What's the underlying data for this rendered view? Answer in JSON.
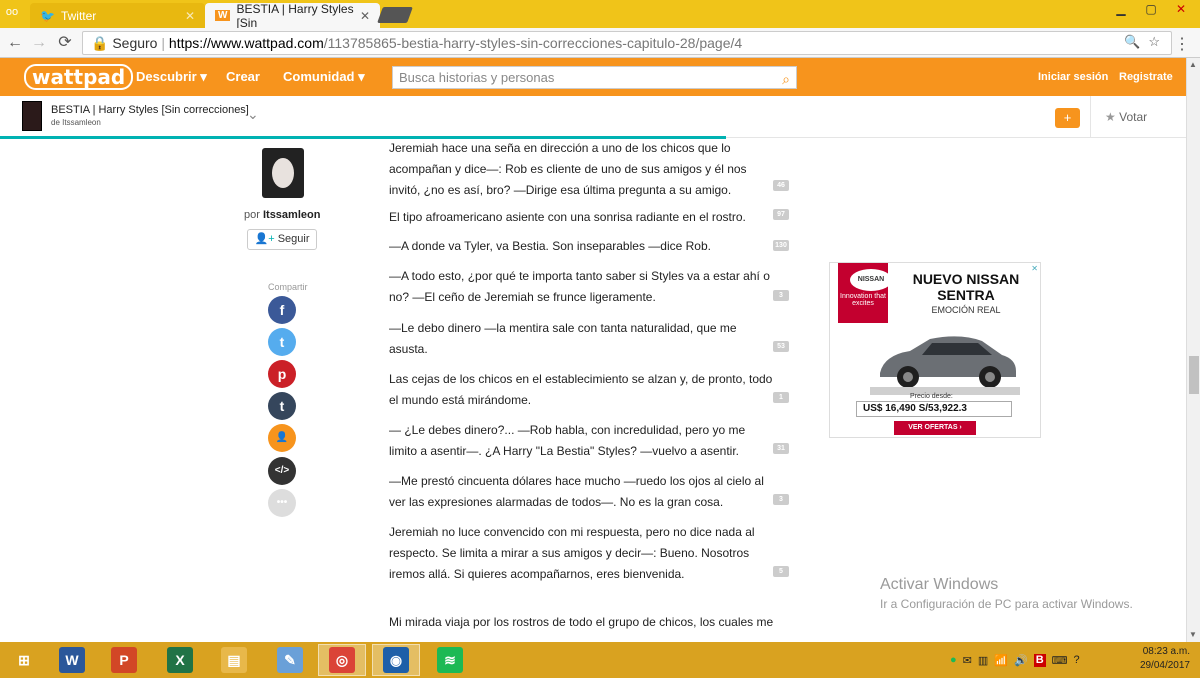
{
  "browser": {
    "tabs": [
      {
        "label": "Twitter",
        "active": false
      },
      {
        "label": "BESTIA | Harry Styles [Sin",
        "active": true
      }
    ],
    "address": {
      "secure_label": "Seguro",
      "host": "https://www.wattpad.com",
      "path": "/113785865-bestia-harry-styles-sin-correcciones-capitulo-28/page/4"
    }
  },
  "wattpad": {
    "logo": "wattpad",
    "nav": {
      "discover": "Descubrir ▾",
      "create": "Crear",
      "community": "Comunidad ▾"
    },
    "search_placeholder": "Busca historias y personas",
    "login": "Iniciar sesión",
    "signup": "Registrate",
    "brand_color": "#f7941d"
  },
  "story": {
    "title": "BESTIA | Harry Styles [Sin correcciones]",
    "author_line": "de Itssamleon",
    "add": "+",
    "vote": "Votar"
  },
  "author": {
    "byline_prefix": "por",
    "name": "Itssamleon",
    "follow": "Seguir"
  },
  "share": {
    "label": "Compartir",
    "buttons": [
      {
        "icon": "facebook-icon",
        "glyph": "f",
        "color": "#3b5998"
      },
      {
        "icon": "twitter-icon",
        "glyph": "t",
        "color": "#55acee"
      },
      {
        "icon": "pinterest-icon",
        "glyph": "p",
        "color": "#cb2027"
      },
      {
        "icon": "tumblr-icon",
        "glyph": "t",
        "color": "#35465c"
      },
      {
        "icon": "user-icon",
        "glyph": "👤",
        "color": "#f7941d"
      },
      {
        "icon": "embed-icon",
        "glyph": "</>",
        "color": "#333333"
      },
      {
        "icon": "more-icon",
        "glyph": "•••",
        "color": "#dddddd"
      }
    ]
  },
  "paragraphs": [
    {
      "text": "Jeremiah hace una seña en dirección a uno de los chicos que lo acompañan y dice—: Rob es cliente de uno de sus amigos y él nos invitó, ¿no es así, bro? —Dirige esa última pregunta a su amigo.",
      "comments": "46"
    },
    {
      "text": "El tipo afroamericano asiente con una sonrisa radiante en el rostro.",
      "comments": "97"
    },
    {
      "text": "—A donde va Tyler, va Bestia. Son inseparables —dice Rob.",
      "comments": "130"
    },
    {
      "text": "—A todo esto, ¿por qué te importa tanto saber si Styles va a estar ahí o no? —El ceño de Jeremiah se frunce ligeramente.",
      "comments": "3"
    },
    {
      "text": "—Le debo dinero —la mentira sale con tanta naturalidad, que me asusta.",
      "comments": "53"
    },
    {
      "text": "Las cejas de los chicos en el establecimiento se alzan y, de pronto, todo el mundo está mirándome.",
      "comments": "1"
    },
    {
      "text": "— ¿Le debes dinero?... —Rob habla, con incredulidad, pero yo me limito a asentir—. ¿A Harry \"La Bestia\" Styles? —vuelvo a asentir.",
      "comments": "31"
    },
    {
      "text": "—Me prestó cincuenta dólares hace mucho —ruedo los ojos al cielo al ver las expresiones alarmadas de todos—. No es la gran cosa.",
      "comments": "3"
    },
    {
      "text": "Jeremiah no luce convencido con mi respuesta, pero no dice nada al respecto. Se limita a mirar a sus amigos y decir—: Bueno. Nosotros iremos allá. Si quieres acompañarnos, eres bienvenida.",
      "comments": "5"
    },
    {
      "text": "Mi mirada viaja por los rostros de todo el grupo de chicos, los cuales me",
      "comments": ""
    }
  ],
  "ad": {
    "logo": "NISSAN",
    "tagline": "Innovation that excites",
    "title": "NUEVO NISSAN SENTRA",
    "subtitle": "EMOCIÓN REAL",
    "price_label": "Precio desde:",
    "price": "US$ 16,490   S/53,922.3",
    "cta": "VER OFERTAS ›"
  },
  "watermark": {
    "title": "Activar Windows",
    "subtitle": "Ir a Configuración de PC para activar Windows."
  },
  "taskbar": {
    "apps": [
      {
        "icon": "windows-start-icon",
        "glyph": "⊞",
        "color": "#d9a220"
      },
      {
        "icon": "word-icon",
        "glyph": "W",
        "color": "#2b579a"
      },
      {
        "icon": "powerpoint-icon",
        "glyph": "P",
        "color": "#d24726"
      },
      {
        "icon": "excel-icon",
        "glyph": "X",
        "color": "#217346"
      },
      {
        "icon": "file-explorer-icon",
        "glyph": "▤",
        "color": "#e8b84a"
      },
      {
        "icon": "paint-icon",
        "glyph": "✎",
        "color": "#6aa0d8"
      },
      {
        "icon": "chrome-icon",
        "glyph": "◎",
        "color": "#db4437"
      },
      {
        "icon": "app-icon",
        "glyph": "◉",
        "color": "#1e5fa8"
      },
      {
        "icon": "spotify-icon",
        "glyph": "≋",
        "color": "#1db954"
      }
    ],
    "time": "08:23 a.m.",
    "date": "29/04/2017"
  }
}
